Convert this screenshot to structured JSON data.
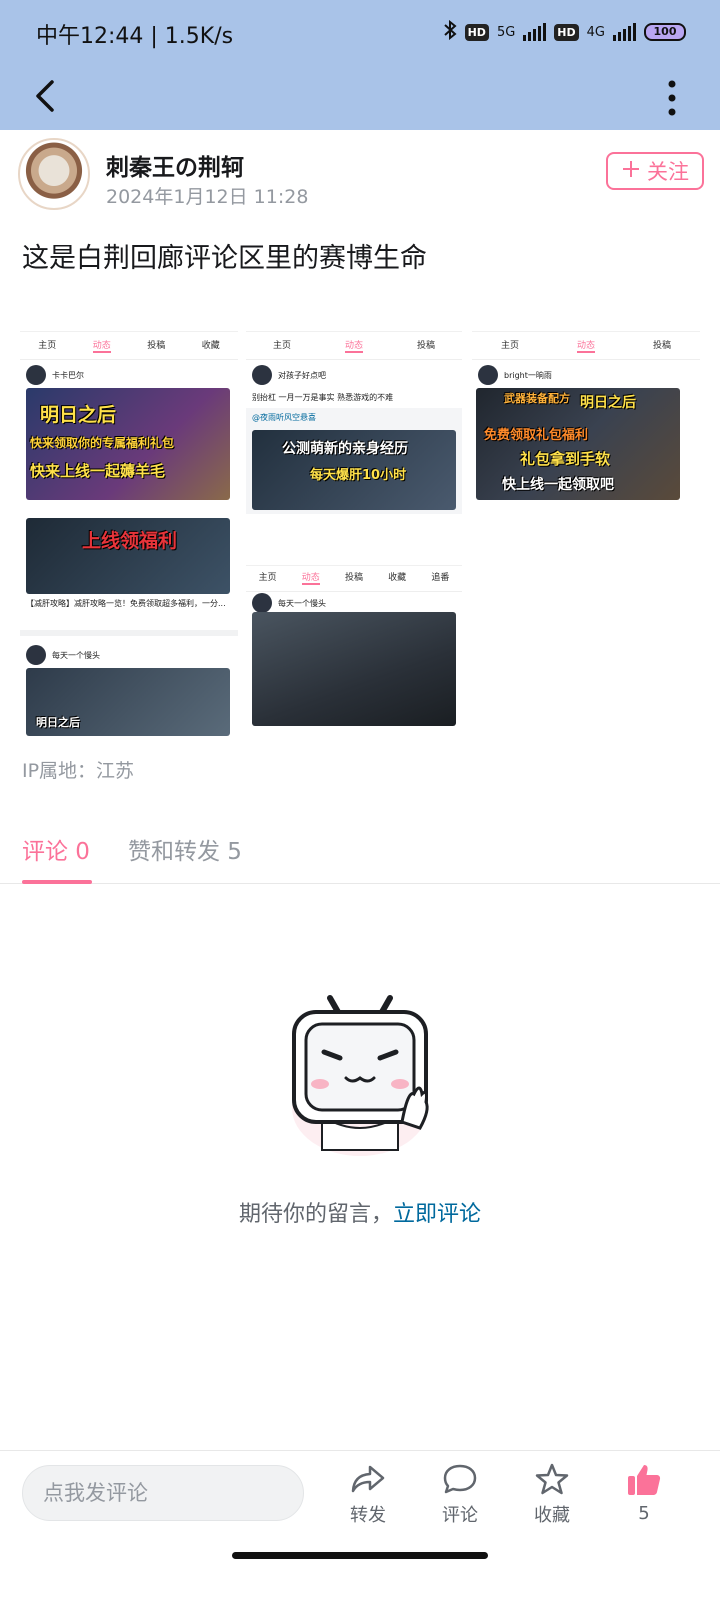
{
  "status_bar": {
    "time_speed": "中午12:44 | 1.5K/s",
    "network_1": "5G",
    "network_2": "4G",
    "hd": "HD",
    "battery": "100"
  },
  "post": {
    "author_name": "刺秦王の荆轲",
    "timestamp": "2024年1月12日 11:28",
    "follow_label": "关注",
    "text": "这是白荆回廊评论区里的赛博生命",
    "ip_location": "IP属地：江苏"
  },
  "screenshots": {
    "shot1": {
      "tabs": [
        "主页",
        "动态",
        "投稿",
        "收藏"
      ],
      "user": "卡卡巴尔",
      "banner_1": "明日之后",
      "banner_2": "快来领取你的专属福利礼包",
      "banner_3": "快来上线一起薅羊毛",
      "banner_4": "上线领福利",
      "caption": "【减肝攻略】减肝攻略一览！免费领取超多福利，一分...",
      "user2": "每天一个慢头",
      "banner_5": "明日之后"
    },
    "shot2": {
      "tabs": [
        "主页",
        "动态",
        "投稿"
      ],
      "user": "对孩子好点吧",
      "post_text": "别抬杠 一月一万是事实 熟悉游戏的不难",
      "repost_from": "@夜雨听风空悬喜",
      "banner_1": "公测萌新的亲身经历",
      "banner_2": "每天爆肝10小时",
      "tabs_2": [
        "主页",
        "动态",
        "投稿",
        "收藏",
        "追番"
      ],
      "user2": "每天一个慢头"
    },
    "shot3": {
      "tabs": [
        "主页",
        "动态",
        "投稿"
      ],
      "user": "bright一晌雨",
      "banner_1": "武器装备配方",
      "banner_2": "明日之后",
      "banner_3": "免费领取礼包福利",
      "banner_4": "礼包拿到手软",
      "banner_5": "快上线一起领取吧"
    }
  },
  "tabs": {
    "comments": "评论 0",
    "likes_reposts": "赞和转发 5"
  },
  "empty_state": {
    "text": "期待你的留言，",
    "link": "立即评论"
  },
  "bottom_bar": {
    "input_placeholder": "点我发评论",
    "share": "转发",
    "comment": "评论",
    "favorite": "收藏",
    "like_count": "5"
  },
  "colors": {
    "accent": "#fb7299",
    "link": "#00699d",
    "header_bg": "#a9c3e8"
  }
}
